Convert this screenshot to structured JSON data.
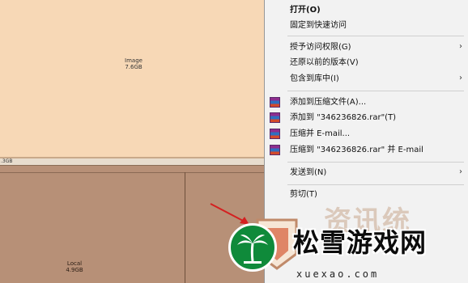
{
  "treemap": {
    "image_tile": {
      "name": "Image",
      "size": "7.6GB"
    },
    "strip_text": ".3GB",
    "local_tile": {
      "name": "Local",
      "size": "4.9GB"
    }
  },
  "context_menu": {
    "items": [
      {
        "label": "打开(O)"
      },
      {
        "label": "固定到快速访问"
      },
      {
        "label": "授予访问权限(G)"
      },
      {
        "label": "还原以前的版本(V)"
      },
      {
        "label": "包含到库中(I)"
      },
      {
        "label": "添加到压缩文件(A)..."
      },
      {
        "label": "添加到 \"346236826.rar\"(T)"
      },
      {
        "label": "压缩并 E-mail..."
      },
      {
        "label": "压缩到 \"346236826.rar\" 并 E-mail"
      },
      {
        "label": "发送到(N)"
      },
      {
        "label": "剪切(T)"
      }
    ],
    "submenu_glyph": "›"
  },
  "watermark": {
    "title": "松雪游戏网",
    "ghost_text": "资讯统",
    "url": "xuexao.com"
  },
  "colors": {
    "image_tile": "#f7d8b6",
    "local_tile": "#b79077",
    "menu_bg": "#f2f2f2",
    "watermark_green": "#0f8a3a"
  }
}
